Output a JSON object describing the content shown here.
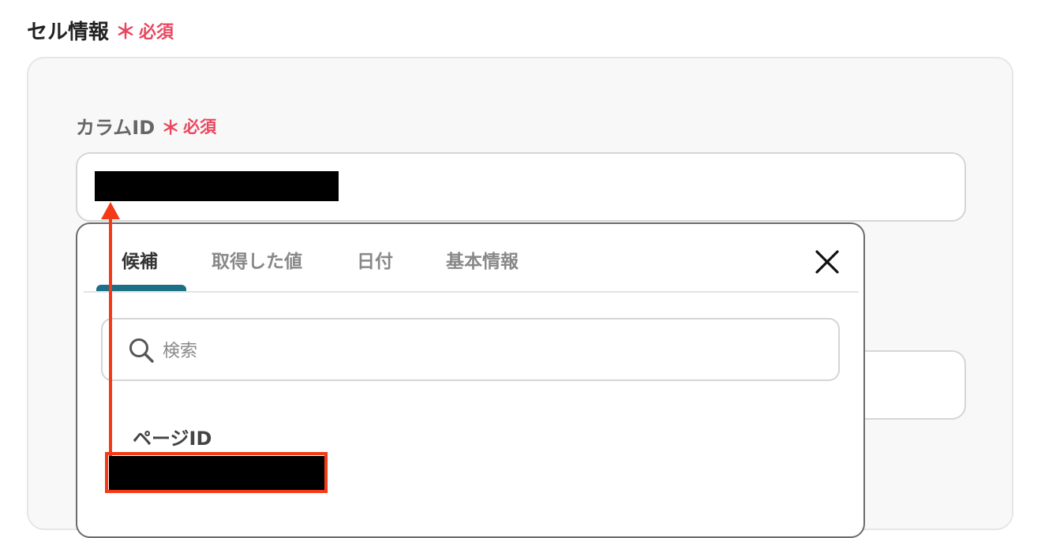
{
  "section": {
    "title": "セル情報",
    "required_mark": "＊",
    "required_text": "必須"
  },
  "column_field": {
    "label": "カラムID",
    "required_mark": "＊",
    "required_text": "必須"
  },
  "popup": {
    "tabs": [
      {
        "label": "候補",
        "active": true
      },
      {
        "label": "取得した値",
        "active": false
      },
      {
        "label": "日付",
        "active": false
      },
      {
        "label": "基本情報",
        "active": false
      }
    ],
    "search": {
      "placeholder": "検索",
      "value": ""
    },
    "item": {
      "label": "ページID"
    }
  },
  "colors": {
    "required": "#e8475f",
    "tab_accent": "#1b6f86",
    "annotation": "#f23a17"
  },
  "icons": [
    "close-icon",
    "search-icon",
    "annotation-arrow"
  ]
}
